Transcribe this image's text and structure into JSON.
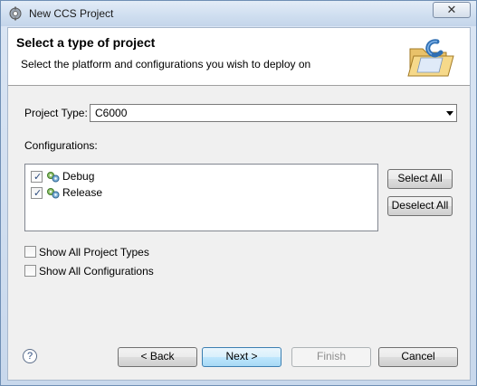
{
  "window": {
    "title": "New CCS Project",
    "close_symbol": "✕"
  },
  "header": {
    "title": "Select a type of project",
    "description": "Select the platform and configurations you wish to deploy on",
    "art_icon": "folder-c-icon"
  },
  "project_type": {
    "label": "Project Type:",
    "value": "C6000"
  },
  "configurations": {
    "label": "Configurations:",
    "items": [
      {
        "label": "Debug",
        "checked": true,
        "icon": "config-gears-icon"
      },
      {
        "label": "Release",
        "checked": true,
        "icon": "config-gears-icon"
      }
    ],
    "select_all": "Select All",
    "deselect_all": "Deselect All"
  },
  "options": {
    "show_all_project_types": {
      "label": "Show All Project Types",
      "checked": false
    },
    "show_all_configurations": {
      "label": "Show All Configurations",
      "checked": false
    }
  },
  "footer": {
    "help_symbol": "?",
    "back": "< Back",
    "next": "Next >",
    "finish": "Finish",
    "cancel": "Cancel"
  },
  "colors": {
    "accent": "#3c7fb1",
    "window_frame": "#c8d8ec"
  }
}
